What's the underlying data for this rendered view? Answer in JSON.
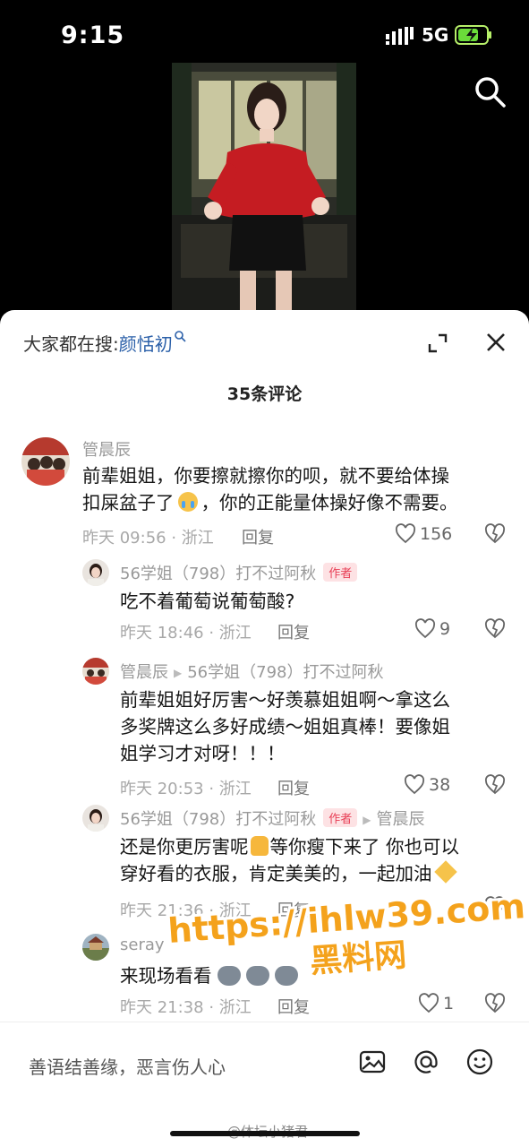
{
  "status": {
    "time": "9:15",
    "network": "5G"
  },
  "sheet": {
    "search_prefix": "大家都在搜:",
    "search_term": "颜恬初",
    "count_label": "35条评论"
  },
  "comments": [
    {
      "user": "管晨辰",
      "text_line1": "前辈姐姐，你要擦就擦你的呗，就不要给体操",
      "text_line2a": "扣屎盆子了",
      "text_line2b": "，你的正能量体操好像不需要。",
      "meta": "昨天 09:56 · 浙江",
      "reply": "回复",
      "likes": "156"
    },
    {
      "user": "56学姐（798）打不过阿秋",
      "tag": "作者",
      "text": "吃不着葡萄说葡萄酸?",
      "meta": "昨天 18:46 · 浙江",
      "reply": "回复",
      "likes": "9"
    },
    {
      "user": "管晨辰",
      "reply_to": "56学姐（798）打不过阿秋",
      "text_line1": "前辈姐姐好厉害～好羡慕姐姐啊～拿这么",
      "text_line2": "多奖牌这么多好成绩～姐姐真棒！要像姐",
      "text_line3": "姐学习才对呀！！！",
      "meta": "昨天 20:53 · 浙江",
      "reply": "回复",
      "likes": "38"
    },
    {
      "user": "56学姐（798）打不过阿秋",
      "tag": "作者",
      "reply_to": "管晨辰",
      "text_line1a": "还是你更厉害呢",
      "text_line1b": "等你瘦下来了 你也可以",
      "text_line2": "穿好看的衣服，肯定美美的，一起加油",
      "meta": "昨天 21:36 · 浙江",
      "reply": "回复"
    },
    {
      "user": "seray",
      "text": "来现场看看",
      "meta": "昨天 21:38 · 浙江",
      "reply": "回复",
      "likes": "1"
    }
  ],
  "input": {
    "placeholder": "善语结善缘，恶言伤人心"
  },
  "watermark": {
    "line1": "https://ihlw39.com",
    "line2": "黑料网"
  },
  "source_mark": "@体坛小猪君",
  "colors": {
    "accent_link": "#2a5fa8",
    "author_tag": "#e83e55",
    "watermark": "#f4a21c"
  }
}
